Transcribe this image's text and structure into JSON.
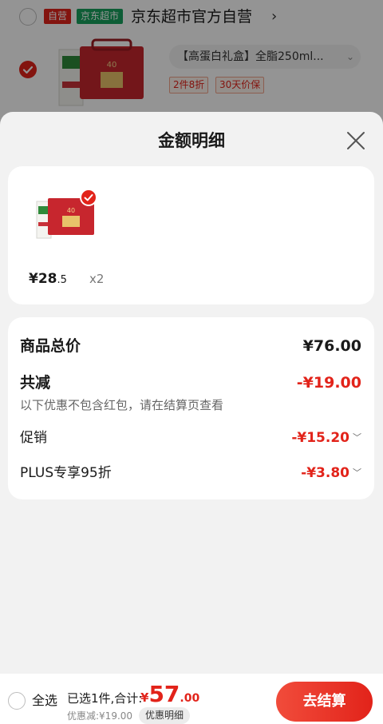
{
  "cart_background": {
    "badge_self": "自营",
    "badge_market": "京东超市",
    "shop_name": "京东超市官方自营",
    "shop_arrow": "›",
    "item_spec": "【高蛋白礼盒】全脂250ml...",
    "promo_tags": [
      "2件8折",
      "30天价保"
    ]
  },
  "sheet": {
    "title": "金额明细",
    "product": {
      "price_int": "¥28",
      "price_dec": ".5",
      "quantity": "x2"
    },
    "summary": {
      "total_label": "商品总价",
      "total_value": "¥76.00",
      "reduce_label": "共减",
      "reduce_value": "-¥19.00",
      "note": "以下优惠不包含红包，请在结算页查看",
      "promo_label": "促销",
      "promo_value": "-¥15.20",
      "plus_label": "PLUS专享95折",
      "plus_value": "-¥3.80"
    }
  },
  "bottom_bar": {
    "select_all": "全选",
    "selected_text": "已选1件,合计:",
    "currency": "¥",
    "total_int": "57",
    "total_dec": ".00",
    "discount_text": "优惠减:¥19.00",
    "detail_button": "优惠明细",
    "checkout_button": "去结算"
  },
  "colors": {
    "accent_red": "#e2231a",
    "market_green": "#18a05e",
    "sheet_bg": "#f2f2f2"
  }
}
